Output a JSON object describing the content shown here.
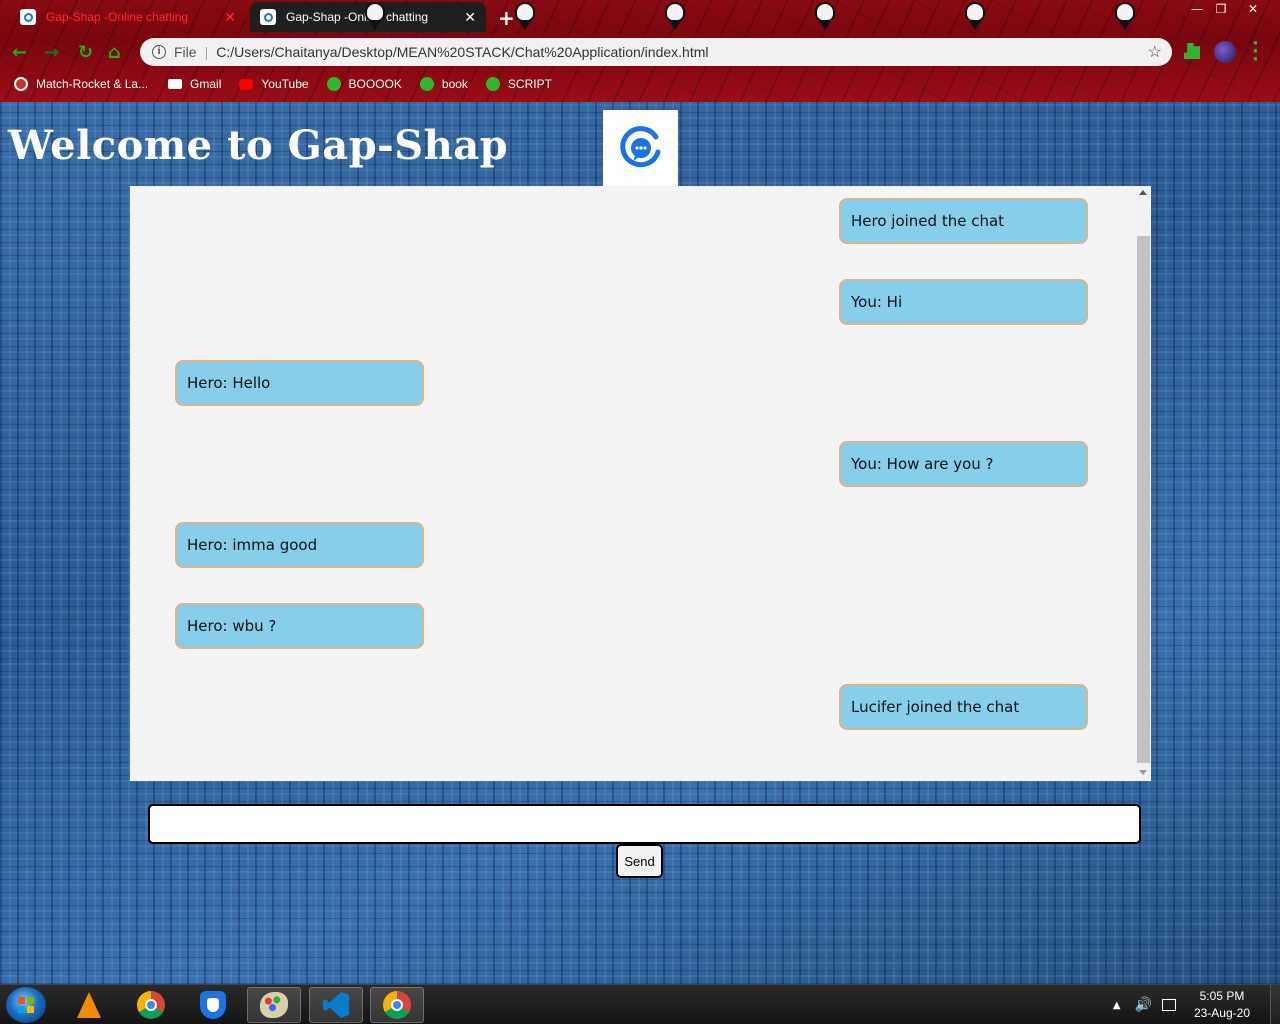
{
  "browser": {
    "tabs": [
      {
        "title": "Gap-Shap -Online chatting",
        "close": "✕"
      },
      {
        "title": "Gap-Shap -Online chatting",
        "close": "✕"
      }
    ],
    "new_tab": "+",
    "address": {
      "scheme_label": "File",
      "url": "C:/Users/Chaitanya/Desktop/MEAN%20STACK/Chat%20Application/index.html"
    },
    "bookmarks": [
      {
        "label": "Match-Rocket & La...",
        "icon": "match-rocket-icon",
        "color": "#c0392b"
      },
      {
        "label": "Gmail",
        "icon": "gmail-icon",
        "color": "#ffffff"
      },
      {
        "label": "YouTube",
        "icon": "youtube-icon",
        "color": "#ff0000"
      },
      {
        "label": "BOOOOK",
        "icon": "globe-icon",
        "color": "#2fb52f"
      },
      {
        "label": "book",
        "icon": "globe-icon",
        "color": "#2fb52f"
      },
      {
        "label": "SCRIPT",
        "icon": "globe-icon",
        "color": "#2fb52f"
      }
    ],
    "window_controls": {
      "minimize": "—",
      "restore": "❐",
      "close": "✕"
    }
  },
  "page": {
    "title": "Welcome to Gap-Shap",
    "messages": [
      {
        "text": "Hero joined the chat",
        "side": "right"
      },
      {
        "text": "You: Hi",
        "side": "right"
      },
      {
        "text": "Hero: Hello",
        "side": "left"
      },
      {
        "text": "You: How are you ?",
        "side": "right"
      },
      {
        "text": "Hero: imma good",
        "side": "left"
      },
      {
        "text": "Hero: wbu ?",
        "side": "left"
      },
      {
        "text": "Lucifer joined the chat",
        "side": "right"
      }
    ],
    "input": {
      "value": "",
      "placeholder": ""
    },
    "send_label": "Send",
    "colors": {
      "bubble": "#87ceeb",
      "bubble_border": "#d9b48c",
      "chat_bg": "#f4f4f4"
    }
  },
  "taskbar": {
    "apps": [
      "start-button",
      "vlc",
      "chrome",
      "brave",
      "paint",
      "vscode",
      "chrome-active"
    ],
    "clock": {
      "time": "5:05 PM",
      "date": "23-Aug-20"
    }
  }
}
